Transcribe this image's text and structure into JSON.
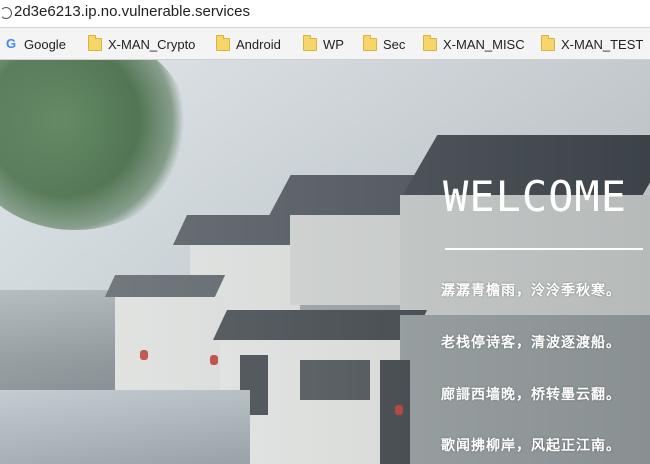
{
  "browser": {
    "url": "2d3e6213.ip.no.vulnerable.services",
    "bookmarks": [
      {
        "label": "Google",
        "icon": "google-icon"
      },
      {
        "label": "X-MAN_Crypto",
        "icon": "folder-icon"
      },
      {
        "label": "Android",
        "icon": "folder-icon"
      },
      {
        "label": "WP",
        "icon": "folder-icon"
      },
      {
        "label": "Sec",
        "icon": "folder-icon"
      },
      {
        "label": "X-MAN_MISC",
        "icon": "folder-icon"
      },
      {
        "label": "X-MAN_TEST",
        "icon": "folder-icon"
      }
    ]
  },
  "hero": {
    "heading": "WELCOME",
    "lines": [
      "潺潺青檐雨，泠泠季秋寒。",
      "老栈停诗客，清波逐渡船。",
      "廊謌西墙晚，桥转墨云翻。",
      "歌闻拂柳岸，风起正江南。"
    ]
  }
}
